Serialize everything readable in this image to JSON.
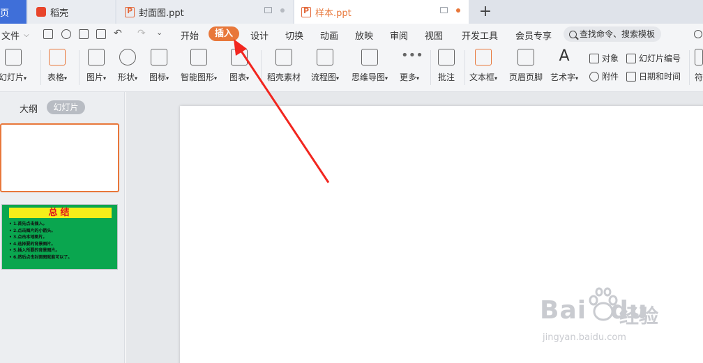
{
  "tabs": {
    "home": "页",
    "daoke": "稻壳",
    "cover": "封面图.ppt",
    "sample": "样本.ppt",
    "add": "+"
  },
  "menu": {
    "file": "文件",
    "items": [
      "开始",
      "插入",
      "设计",
      "切换",
      "动画",
      "放映",
      "审阅",
      "视图",
      "开发工具",
      "会员专享"
    ],
    "active": "插入",
    "search_placeholder": "查找命令、搜索模板"
  },
  "ribbon": {
    "new_slide": "新幻灯片",
    "table": "表格",
    "picture": "图片",
    "shape": "形状",
    "icon": "图标",
    "smartart": "智能图形",
    "chart": "图表",
    "daoke_material": "稻壳素材",
    "flowchart": "流程图",
    "mindmap": "思维导图",
    "more": "更多",
    "comment": "批注",
    "textbox": "文本框",
    "header_footer": "页眉页脚",
    "wordart": "艺术字",
    "object": "对象",
    "slide_number": "幻灯片编号",
    "attachment": "附件",
    "date_time": "日期和时间",
    "symbol": "符"
  },
  "left_panel": {
    "outline": "大纲",
    "slides": "幻灯片"
  },
  "thumbnail2": {
    "title": "总结",
    "lines": [
      "1.首先点击插入。",
      "2.点击图片的小箭头。",
      "3.点击本地图片。",
      "4.选择要的背景图片。",
      "5.插入所要的背景图片。",
      "6.然后点击封面图就能可以了。"
    ]
  },
  "watermark": {
    "brand": "Bai",
    "brand2": "du",
    "cn": "经验",
    "url": "jingyan.baidu.com"
  },
  "colors": {
    "accent": "#e8773a",
    "arrow": "#f2261f",
    "slide_green": "#0aa64f",
    "title_yellow": "#f6ee1a"
  }
}
